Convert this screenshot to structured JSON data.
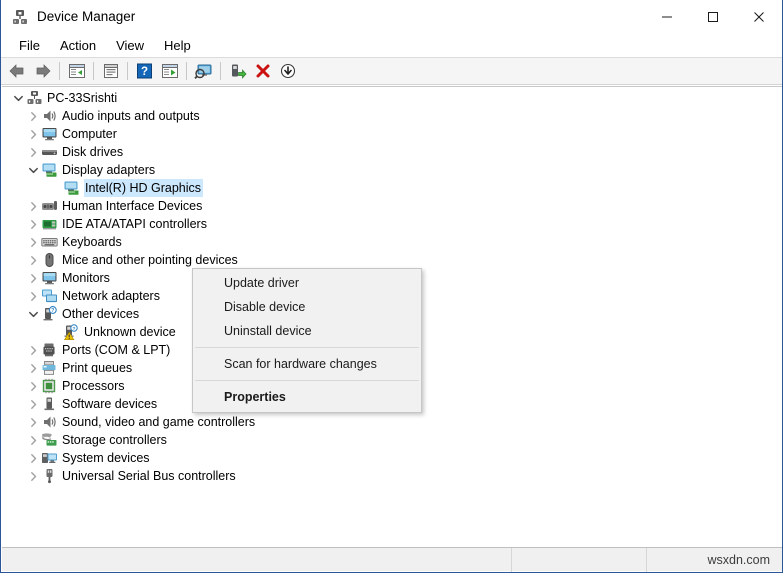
{
  "window": {
    "title": "Device Manager",
    "icon": "device-manager-icon",
    "accent_border": "#2b5797",
    "selection_color": "#cce8ff"
  },
  "caption": {
    "minimize": "—",
    "maximize": "□",
    "close": "✕"
  },
  "menubar": {
    "items": [
      {
        "label": "File"
      },
      {
        "label": "Action"
      },
      {
        "label": "View"
      },
      {
        "label": "Help"
      }
    ]
  },
  "toolbar": {
    "buttons": [
      {
        "name": "back-icon",
        "tip": "Back"
      },
      {
        "name": "forward-icon",
        "tip": "Forward"
      },
      {
        "name": "show-hide-console-tree-icon",
        "tip": "Show/Hide console tree"
      },
      {
        "name": "properties-icon",
        "tip": "Properties"
      },
      {
        "name": "help-icon",
        "tip": "Help"
      },
      {
        "name": "update-driver-icon",
        "tip": "Update driver"
      },
      {
        "name": "scan-hardware-changes-icon",
        "tip": "Scan for hardware changes"
      },
      {
        "name": "enable-device-icon",
        "tip": "Enable device"
      },
      {
        "name": "uninstall-device-icon",
        "tip": "Uninstall device"
      },
      {
        "name": "disable-device-icon",
        "tip": "Disable device"
      }
    ]
  },
  "tree": {
    "items": [
      {
        "label": "PC-33Srishti",
        "level": 0,
        "expander": "expanded",
        "icon": "computer-root-icon",
        "selected": false
      },
      {
        "label": "Audio inputs and outputs",
        "level": 1,
        "expander": "collapsed",
        "icon": "speaker-icon",
        "selected": false
      },
      {
        "label": "Computer",
        "level": 1,
        "expander": "collapsed",
        "icon": "monitor-icon",
        "selected": false
      },
      {
        "label": "Disk drives",
        "level": 1,
        "expander": "collapsed",
        "icon": "disk-drive-icon",
        "selected": false
      },
      {
        "label": "Display adapters",
        "level": 1,
        "expander": "expanded",
        "icon": "display-adapter-icon",
        "selected": false
      },
      {
        "label": "Intel(R) HD Graphics",
        "level": 2,
        "expander": "none",
        "icon": "display-adapter-icon",
        "selected": true
      },
      {
        "label": "Human Interface Devices",
        "level": 1,
        "expander": "collapsed",
        "icon": "hid-icon",
        "selected": false
      },
      {
        "label": "IDE ATA/ATAPI controllers",
        "level": 1,
        "expander": "collapsed",
        "icon": "ide-controller-icon",
        "selected": false
      },
      {
        "label": "Keyboards",
        "level": 1,
        "expander": "collapsed",
        "icon": "keyboard-icon",
        "selected": false
      },
      {
        "label": "Mice and other pointing devices",
        "level": 1,
        "expander": "collapsed",
        "icon": "mouse-icon",
        "selected": false
      },
      {
        "label": "Monitors",
        "level": 1,
        "expander": "collapsed",
        "icon": "monitor-icon",
        "selected": false
      },
      {
        "label": "Network adapters",
        "level": 1,
        "expander": "collapsed",
        "icon": "network-adapter-icon",
        "selected": false
      },
      {
        "label": "Other devices",
        "level": 1,
        "expander": "expanded",
        "icon": "other-device-icon",
        "selected": false
      },
      {
        "label": "Unknown device",
        "level": 2,
        "expander": "none",
        "icon": "unknown-device-warning-icon",
        "selected": false
      },
      {
        "label": "Ports (COM & LPT)",
        "level": 1,
        "expander": "collapsed",
        "icon": "port-icon",
        "selected": false
      },
      {
        "label": "Print queues",
        "level": 1,
        "expander": "collapsed",
        "icon": "printer-icon",
        "selected": false
      },
      {
        "label": "Processors",
        "level": 1,
        "expander": "collapsed",
        "icon": "processor-icon",
        "selected": false
      },
      {
        "label": "Software devices",
        "level": 1,
        "expander": "collapsed",
        "icon": "software-device-icon",
        "selected": false
      },
      {
        "label": "Sound, video and game controllers",
        "level": 1,
        "expander": "collapsed",
        "icon": "speaker-icon",
        "selected": false
      },
      {
        "label": "Storage controllers",
        "level": 1,
        "expander": "collapsed",
        "icon": "storage-controller-icon",
        "selected": false
      },
      {
        "label": "System devices",
        "level": 1,
        "expander": "collapsed",
        "icon": "system-device-icon",
        "selected": false
      },
      {
        "label": "Universal Serial Bus controllers",
        "level": 1,
        "expander": "collapsed",
        "icon": "usb-icon",
        "selected": false
      }
    ]
  },
  "context_menu": {
    "items": [
      {
        "label": "Update driver",
        "bold": false,
        "separator_after": false
      },
      {
        "label": "Disable device",
        "bold": false,
        "separator_after": false
      },
      {
        "label": "Uninstall device",
        "bold": false,
        "separator_after": true
      },
      {
        "label": "Scan for hardware changes",
        "bold": false,
        "separator_after": true
      },
      {
        "label": "Properties",
        "bold": true,
        "separator_after": false
      }
    ]
  },
  "statusbar": {
    "main": "",
    "middle": "",
    "watermark": "wsxdn.com"
  }
}
